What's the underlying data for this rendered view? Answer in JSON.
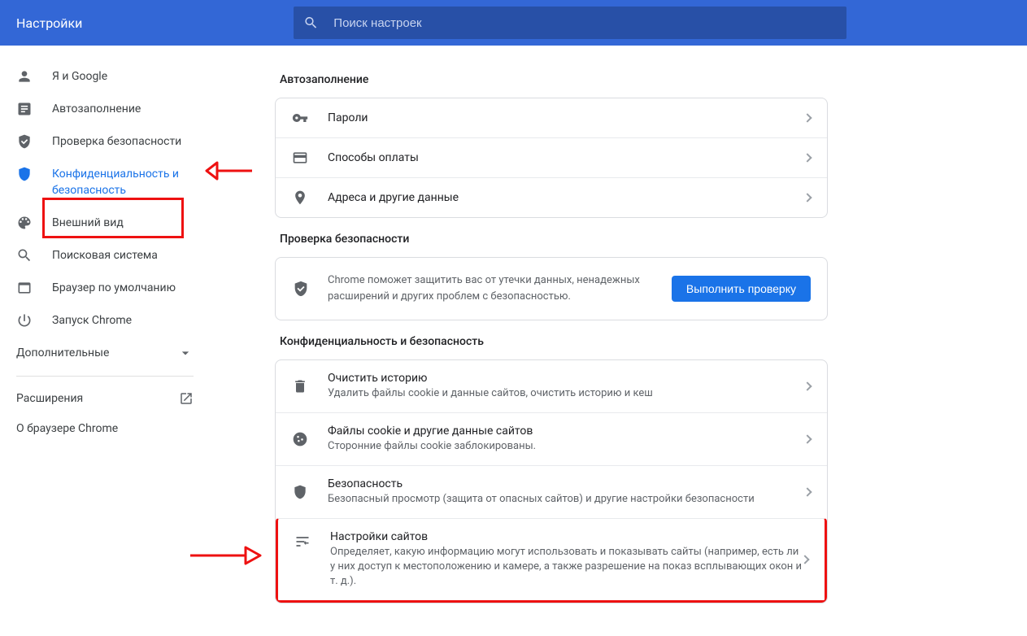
{
  "header": {
    "title": "Настройки",
    "searchPlaceholder": "Поиск настроек"
  },
  "sidebar": {
    "items": [
      {
        "label": "Я и Google"
      },
      {
        "label": "Автозаполнение"
      },
      {
        "label": "Проверка безопасности"
      },
      {
        "label": "Конфиденциальность и безопасность"
      },
      {
        "label": "Внешний вид"
      },
      {
        "label": "Поисковая система"
      },
      {
        "label": "Браузер по умолчанию"
      },
      {
        "label": "Запуск Chrome"
      }
    ],
    "advanced": "Дополнительные",
    "extensions": "Расширения",
    "about": "О браузере Chrome"
  },
  "sections": {
    "autofill": {
      "title": "Автозаполнение",
      "rows": [
        {
          "label": "Пароли"
        },
        {
          "label": "Способы оплаты"
        },
        {
          "label": "Адреса и другие данные"
        }
      ]
    },
    "safety": {
      "title": "Проверка безопасности",
      "text": "Chrome поможет защитить вас от утечки данных, ненадежных расширений и других проблем с безопасностью.",
      "button": "Выполнить проверку"
    },
    "privacy": {
      "title": "Конфиденциальность и безопасность",
      "rows": [
        {
          "title": "Очистить историю",
          "sub": "Удалить файлы cookie и данные сайтов, очистить историю и кеш"
        },
        {
          "title": "Файлы cookie и другие данные сайтов",
          "sub": "Сторонние файлы cookie заблокированы."
        },
        {
          "title": "Безопасность",
          "sub": "Безопасный просмотр (защита от опасных сайтов) и другие настройки безопасности"
        },
        {
          "title": "Настройки сайтов",
          "sub": "Определяет, какую информацию могут использовать и показывать сайты (например, есть ли у них доступ к местоположению и камере, а также разрешение на показ всплывающих окон и т. д.)."
        }
      ]
    }
  }
}
